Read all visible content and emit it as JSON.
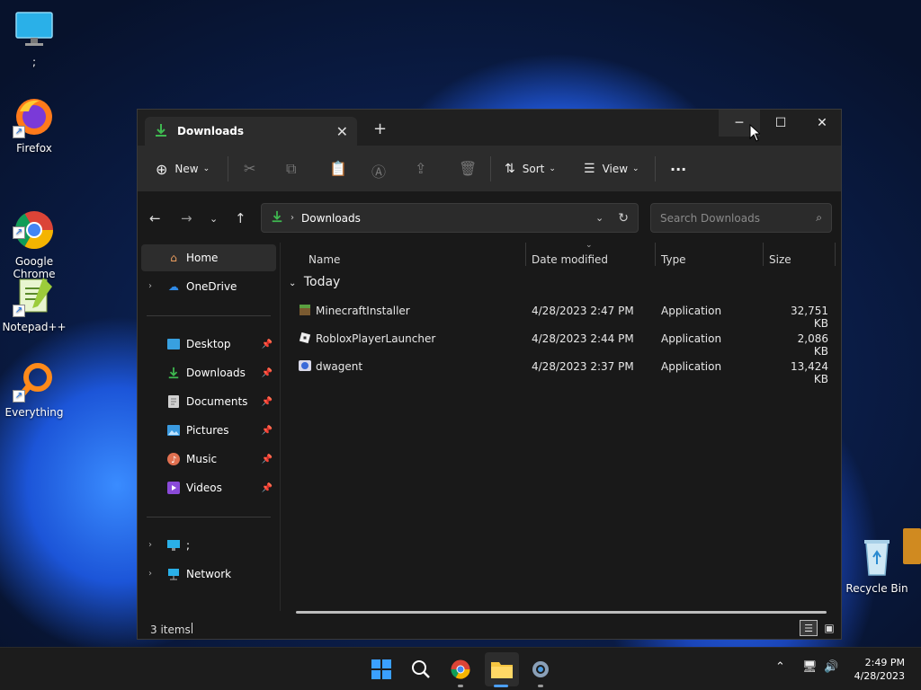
{
  "desktop": {
    "icons": [
      {
        "label": ";",
        "icon": "monitor-icon"
      },
      {
        "label": "Firefox",
        "icon": "firefox-icon"
      },
      {
        "label": "Google\nChrome",
        "icon": "chrome-icon"
      },
      {
        "label": "Notepad++",
        "icon": "notepad-icon"
      },
      {
        "label": "Everything",
        "icon": "everything-icon"
      }
    ],
    "recycle_bin": "Recycle Bin"
  },
  "window": {
    "tab_title": "Downloads",
    "toolbar": {
      "new_label": "New",
      "sort_label": "Sort",
      "view_label": "View",
      "more_label": "···"
    },
    "address": {
      "path": "Downloads"
    },
    "search": {
      "placeholder": "Search Downloads"
    },
    "sidebar": {
      "home": "Home",
      "onedrive": "OneDrive",
      "quick": [
        "Desktop",
        "Downloads",
        "Documents",
        "Pictures",
        "Music",
        "Videos"
      ],
      "thispc": ";",
      "network": "Network"
    },
    "columns": [
      "Name",
      "Date modified",
      "Type",
      "Size"
    ],
    "group": "Today",
    "files": [
      {
        "name": "MinecraftInstaller",
        "date": "4/28/2023 2:47 PM",
        "type": "Application",
        "size": "32,751 KB"
      },
      {
        "name": "RobloxPlayerLauncher",
        "date": "4/28/2023 2:44 PM",
        "type": "Application",
        "size": "2,086 KB"
      },
      {
        "name": "dwagent",
        "date": "4/28/2023 2:37 PM",
        "type": "Application",
        "size": "13,424 KB"
      }
    ],
    "status": "3 items"
  },
  "taskbar": {
    "time": "2:49 PM",
    "date": "4/28/2023"
  },
  "colors": {
    "accent_green": "#3fb950",
    "folder_blue": "#2f8ae6"
  }
}
